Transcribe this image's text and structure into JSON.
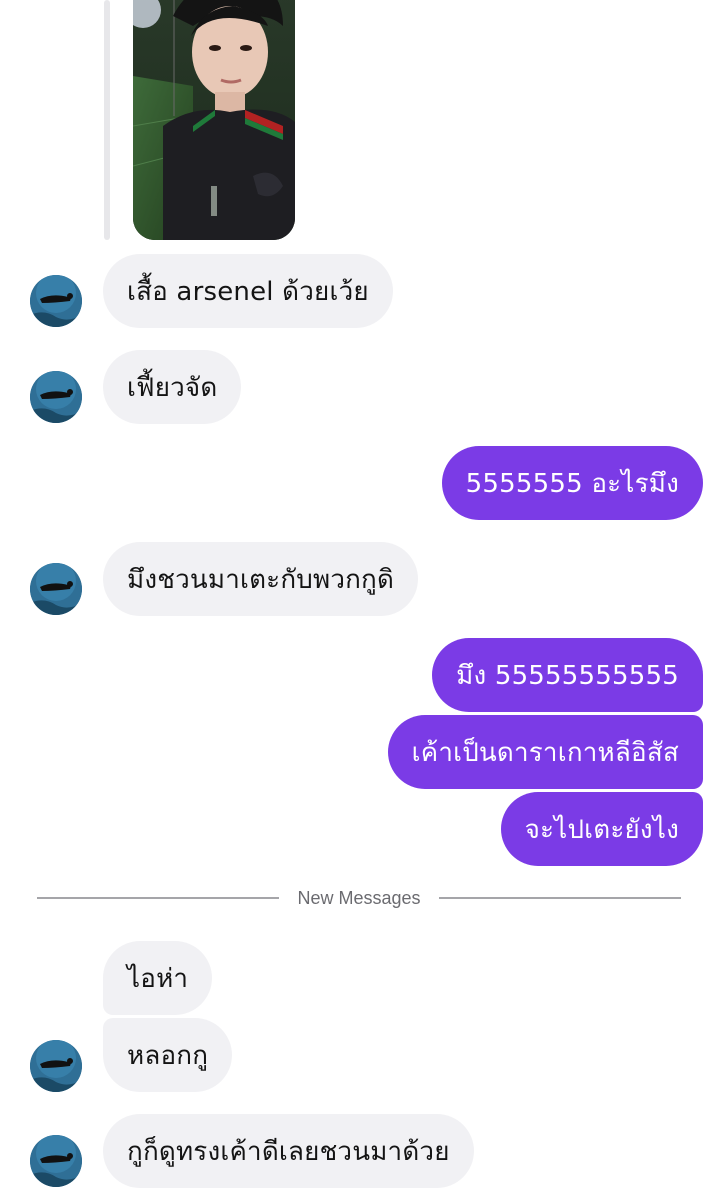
{
  "messages": {
    "m1": "เสื้อ arsenel ด้วยเว้ย",
    "m2": "เฟี้ยวจัด",
    "m3": "5555555 อะไรมึง",
    "m4": "มึงชวนมาเตะกับพวกกูดิ",
    "m5": "มึง 55555555555",
    "m6": "เค้าเป็นดาราเกาหลีอิสัส",
    "m7": "จะไปเตะยังไง",
    "m8": "ไอห่า",
    "m9": "หลอกกู",
    "m10": "กูก็ดูทรงเค้าดีเลยชวนมาด้วย"
  },
  "divider": {
    "label": "New Messages"
  },
  "colors": {
    "outgoing_bubble": "#7b3be6",
    "incoming_bubble": "#f1f1f4"
  },
  "icons": {
    "avatar": "diver-underwater-avatar-icon"
  }
}
